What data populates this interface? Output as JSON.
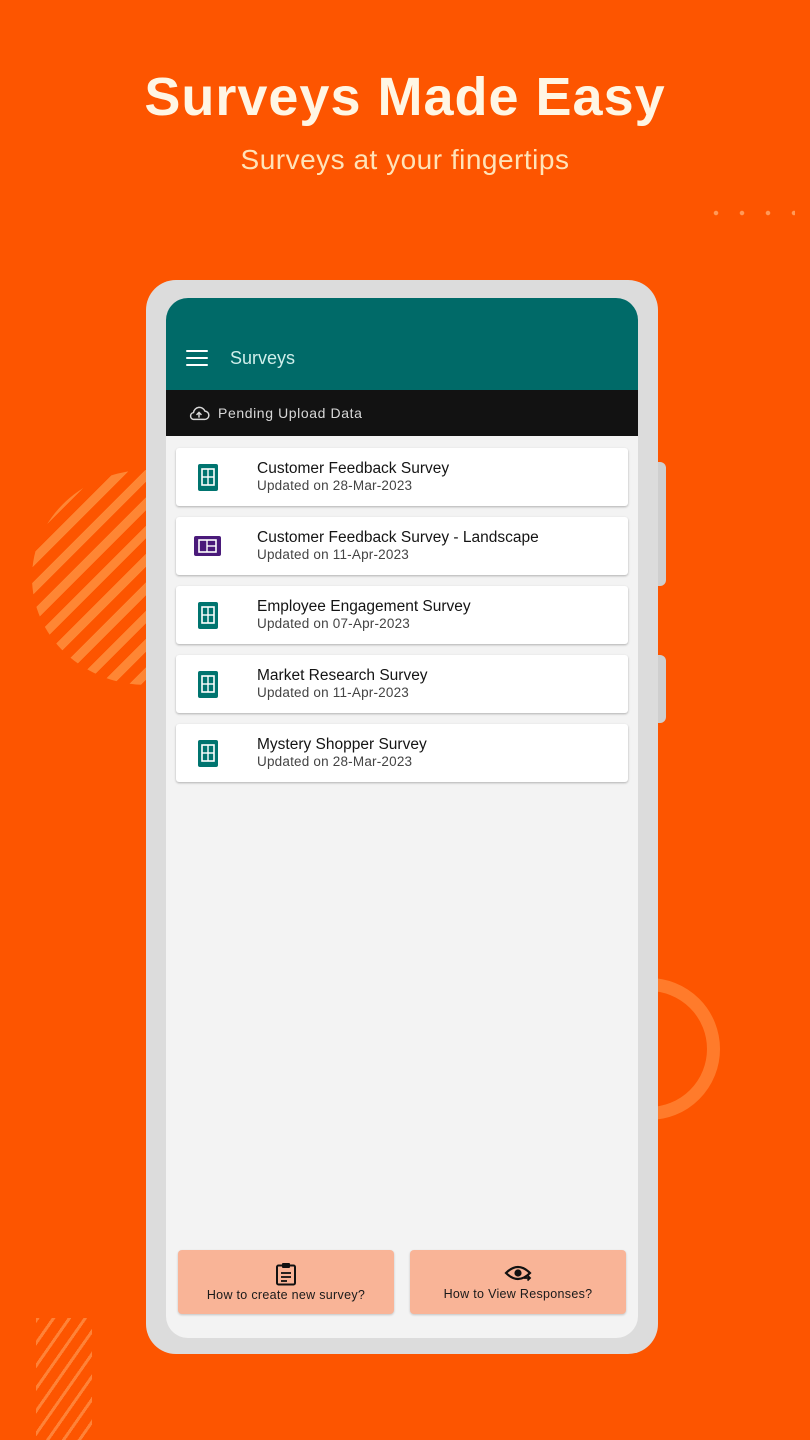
{
  "promo": {
    "headline": "Surveys Made Easy",
    "subline": "Surveys at your fingertips"
  },
  "appbar": {
    "title": "Surveys",
    "menu_icon": "hamburger-menu-icon"
  },
  "pending_bar": {
    "label": "Pending Upload Data",
    "icon": "cloud-upload-icon"
  },
  "surveys": [
    {
      "title": "Customer Feedback Survey",
      "updated": "Updated on 28-Mar-2023",
      "orientation": "portrait",
      "icon_color": "#00746f"
    },
    {
      "title": "Customer Feedback Survey - Landscape",
      "updated": "Updated on 11-Apr-2023",
      "orientation": "landscape",
      "icon_color": "#4a1a7a"
    },
    {
      "title": "Employee Engagement Survey",
      "updated": "Updated on 07-Apr-2023",
      "orientation": "portrait",
      "icon_color": "#00746f"
    },
    {
      "title": "Market Research Survey",
      "updated": "Updated on 11-Apr-2023",
      "orientation": "portrait",
      "icon_color": "#00746f"
    },
    {
      "title": "Mystery Shopper Survey",
      "updated": "Updated on 28-Mar-2023",
      "orientation": "portrait",
      "icon_color": "#00746f"
    }
  ],
  "help_buttons": {
    "create": {
      "label": "How to create new survey?",
      "icon": "clipboard-icon"
    },
    "responses": {
      "label": "How to View Responses?",
      "icon": "eye-icon"
    }
  },
  "colors": {
    "background": "#fd5500",
    "appbar": "#006a68",
    "pending_bar": "#121212",
    "help_button": "#f9b497"
  }
}
